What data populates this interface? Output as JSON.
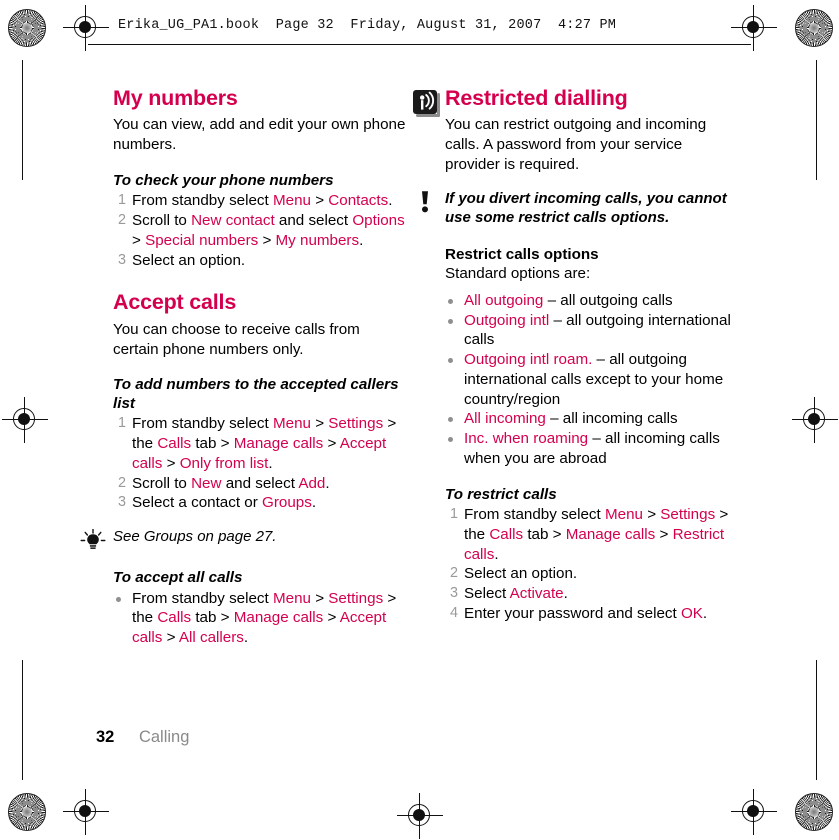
{
  "header": {
    "text": "Erika_UG_PA1.book  Page 32  Friday, August 31, 2007  4:27 PM"
  },
  "footer": {
    "page_number": "32",
    "chapter": "Calling"
  },
  "accent_color": "#D4004E",
  "left_column": {
    "section1": {
      "title": "My numbers",
      "intro": "You can view, add and edit your own phone numbers.",
      "task_title": "To check your phone numbers",
      "steps": [
        {
          "num": "1",
          "parts": [
            {
              "t": "From standby select ",
              "c": "black"
            },
            {
              "t": "Menu",
              "c": "mag"
            },
            {
              "t": " > ",
              "c": "black"
            },
            {
              "t": "Contacts",
              "c": "mag"
            },
            {
              "t": ".",
              "c": "black"
            }
          ]
        },
        {
          "num": "2",
          "parts": [
            {
              "t": "Scroll to ",
              "c": "black"
            },
            {
              "t": "New contact",
              "c": "mag"
            },
            {
              "t": " and select ",
              "c": "black"
            },
            {
              "t": "Options",
              "c": "mag"
            },
            {
              "t": " > ",
              "c": "black"
            },
            {
              "t": "Special numbers",
              "c": "mag"
            },
            {
              "t": " > ",
              "c": "black"
            },
            {
              "t": "My numbers",
              "c": "mag"
            },
            {
              "t": ".",
              "c": "black"
            }
          ]
        },
        {
          "num": "3",
          "parts": [
            {
              "t": "Select an option.",
              "c": "black"
            }
          ]
        }
      ]
    },
    "section2": {
      "title": "Accept calls",
      "intro": "You can choose to receive calls from certain phone numbers only.",
      "task_title": "To add numbers to the accepted callers list",
      "steps": [
        {
          "num": "1",
          "parts": [
            {
              "t": "From standby select ",
              "c": "black"
            },
            {
              "t": "Menu",
              "c": "mag"
            },
            {
              "t": " > ",
              "c": "black"
            },
            {
              "t": "Settings",
              "c": "mag"
            },
            {
              "t": " > the ",
              "c": "black"
            },
            {
              "t": "Calls",
              "c": "mag"
            },
            {
              "t": " tab > ",
              "c": "black"
            },
            {
              "t": "Manage calls",
              "c": "mag"
            },
            {
              "t": " > ",
              "c": "black"
            },
            {
              "t": "Accept calls",
              "c": "mag"
            },
            {
              "t": " > ",
              "c": "black"
            },
            {
              "t": "Only from list",
              "c": "mag"
            },
            {
              "t": ".",
              "c": "black"
            }
          ]
        },
        {
          "num": "2",
          "parts": [
            {
              "t": "Scroll to ",
              "c": "black"
            },
            {
              "t": "New",
              "c": "mag"
            },
            {
              "t": " and select ",
              "c": "black"
            },
            {
              "t": "Add",
              "c": "mag"
            },
            {
              "t": ".",
              "c": "black"
            }
          ]
        },
        {
          "num": "3",
          "parts": [
            {
              "t": "Select a contact or ",
              "c": "black"
            },
            {
              "t": "Groups",
              "c": "mag"
            },
            {
              "t": ".",
              "c": "black"
            }
          ]
        }
      ],
      "tip_note": "See Groups on page 27.",
      "tip_icon": "lightbulb-tip-icon",
      "task_title2": "To accept all calls",
      "bullet_steps": [
        {
          "parts": [
            {
              "t": "From standby select ",
              "c": "black"
            },
            {
              "t": "Menu",
              "c": "mag"
            },
            {
              "t": " > ",
              "c": "black"
            },
            {
              "t": "Settings",
              "c": "mag"
            },
            {
              "t": " > the ",
              "c": "black"
            },
            {
              "t": "Calls",
              "c": "mag"
            },
            {
              "t": " tab > ",
              "c": "black"
            },
            {
              "t": "Manage calls",
              "c": "mag"
            },
            {
              "t": " > ",
              "c": "black"
            },
            {
              "t": "Accept calls",
              "c": "mag"
            },
            {
              "t": " > ",
              "c": "black"
            },
            {
              "t": "All callers",
              "c": "mag"
            },
            {
              "t": ".",
              "c": "black"
            }
          ]
        }
      ]
    }
  },
  "right_column": {
    "section1": {
      "title": "Restricted dialling",
      "icon": "network-antenna-icon",
      "intro": "You can restrict outgoing and incoming calls. A password from your service provider is required.",
      "warning_icon": "exclamation-warning-icon",
      "warning_note": "If you divert incoming calls, you cannot use some restrict calls options.",
      "sub_head": "Restrict calls options",
      "sub_intro": "Standard options are:",
      "options": [
        {
          "parts": [
            {
              "t": "All outgoing",
              "c": "mag"
            },
            {
              "t": " – all outgoing calls",
              "c": "black"
            }
          ]
        },
        {
          "parts": [
            {
              "t": "Outgoing intl",
              "c": "mag"
            },
            {
              "t": " – all outgoing international calls",
              "c": "black"
            }
          ]
        },
        {
          "parts": [
            {
              "t": "Outgoing intl roam.",
              "c": "mag"
            },
            {
              "t": " – all outgoing international calls except to your home country/region",
              "c": "black"
            }
          ]
        },
        {
          "parts": [
            {
              "t": "All incoming",
              "c": "mag"
            },
            {
              "t": " – all incoming calls",
              "c": "black"
            }
          ]
        },
        {
          "parts": [
            {
              "t": "Inc. when roaming",
              "c": "mag"
            },
            {
              "t": " – all incoming calls when you are abroad",
              "c": "black"
            }
          ]
        }
      ],
      "task_title": "To restrict calls",
      "steps": [
        {
          "num": "1",
          "parts": [
            {
              "t": "From standby select ",
              "c": "black"
            },
            {
              "t": "Menu",
              "c": "mag"
            },
            {
              "t": " > ",
              "c": "black"
            },
            {
              "t": "Settings",
              "c": "mag"
            },
            {
              "t": " > the ",
              "c": "black"
            },
            {
              "t": "Calls",
              "c": "mag"
            },
            {
              "t": " tab > ",
              "c": "black"
            },
            {
              "t": "Manage calls",
              "c": "mag"
            },
            {
              "t": " > ",
              "c": "black"
            },
            {
              "t": "Restrict calls",
              "c": "mag"
            },
            {
              "t": ".",
              "c": "black"
            }
          ]
        },
        {
          "num": "2",
          "parts": [
            {
              "t": "Select an option.",
              "c": "black"
            }
          ]
        },
        {
          "num": "3",
          "parts": [
            {
              "t": "Select ",
              "c": "black"
            },
            {
              "t": "Activate",
              "c": "mag"
            },
            {
              "t": ".",
              "c": "black"
            }
          ]
        },
        {
          "num": "4",
          "parts": [
            {
              "t": "Enter your password and select ",
              "c": "black"
            },
            {
              "t": "OK",
              "c": "mag"
            },
            {
              "t": ".",
              "c": "black"
            }
          ]
        }
      ]
    }
  }
}
